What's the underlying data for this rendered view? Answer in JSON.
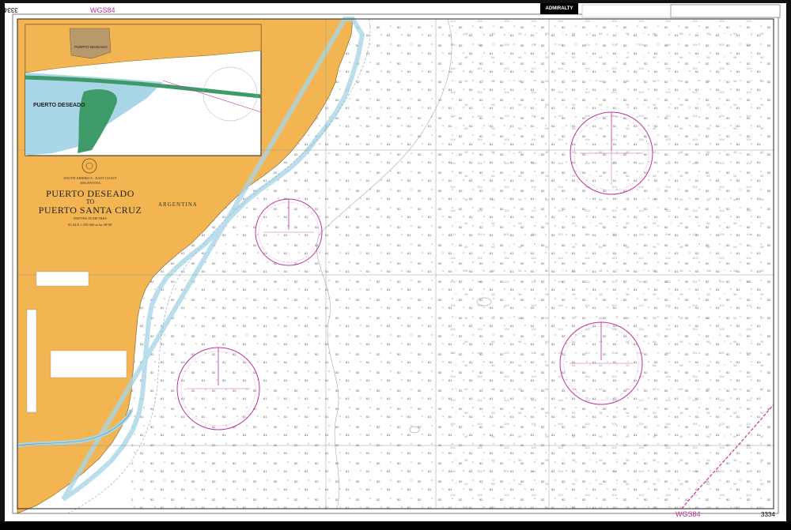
{
  "chart": {
    "number": "3334",
    "datum_label": "WGS84",
    "publisher_badge": "ADMIRALTY",
    "region": "SOUTH AMERICA - EAST COAST",
    "country": "ARGENTINA",
    "title_line1": "PUERTO DESEADO",
    "title_to": "TO",
    "title_line2": "PUERTO SANTA CRUZ",
    "depths_note": "DEPTHS IN METRES",
    "scale_text": "SCALE 1:350 000 at lat 48°00'",
    "land_label": "ARGENTINA"
  },
  "inset": {
    "title": "PUERTO DESEADO",
    "town_label": "PUERTO DESEADO"
  },
  "colors": {
    "land": "#f2b552",
    "shallow_water": "#a9d6e6",
    "drying_area": "#3f9a6a",
    "sea": "#ffffff",
    "magenta": "#c0309a",
    "grid": "#9a9a9a",
    "contour": "#8fb4c2"
  },
  "compass_roses": [
    {
      "name": "rose-north-east"
    },
    {
      "name": "rose-central"
    },
    {
      "name": "rose-south-west"
    },
    {
      "name": "rose-south-east"
    }
  ]
}
